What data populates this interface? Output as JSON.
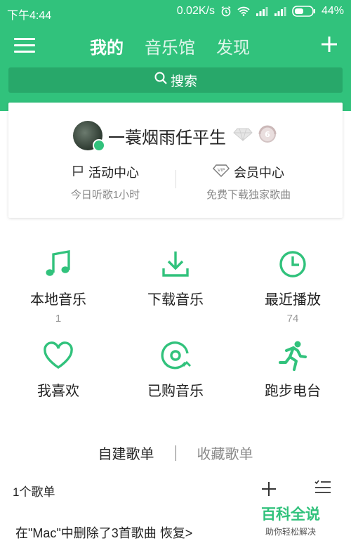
{
  "status_bar": {
    "time": "下午4:44",
    "speed": "0.02K/s",
    "battery": "44%"
  },
  "nav": {
    "tabs": [
      "我的",
      "音乐馆",
      "发现"
    ],
    "active_tab": "我的"
  },
  "search": {
    "label": "搜索"
  },
  "profile": {
    "username": "一蓑烟雨任平生",
    "activity": {
      "title": "活动中心",
      "subtitle": "今日听歌1小时"
    },
    "vip": {
      "title": "会员中心",
      "subtitle": "免费下载独家歌曲"
    }
  },
  "grid": [
    {
      "label": "本地音乐",
      "count": "1",
      "icon": "music-note-icon"
    },
    {
      "label": "下载音乐",
      "count": "",
      "icon": "download-icon"
    },
    {
      "label": "最近播放",
      "count": "74",
      "icon": "clock-icon"
    },
    {
      "label": "我喜欢",
      "count": "",
      "icon": "heart-icon"
    },
    {
      "label": "已购音乐",
      "count": "",
      "icon": "purchased-disc-icon"
    },
    {
      "label": "跑步电台",
      "count": "",
      "icon": "running-icon"
    }
  ],
  "playlist_tabs": {
    "created": "自建歌单",
    "favorited": "收藏歌单"
  },
  "playlist": {
    "count_label": "1个歌单"
  },
  "notice": {
    "text": "在\"Mac\"中删除了3首歌曲",
    "action": "恢复>"
  },
  "watermark": {
    "title": "百科全说",
    "subtitle": "助你轻松解决"
  },
  "colors": {
    "brand_green": "#31c27c",
    "search_bg": "#28a86a"
  }
}
